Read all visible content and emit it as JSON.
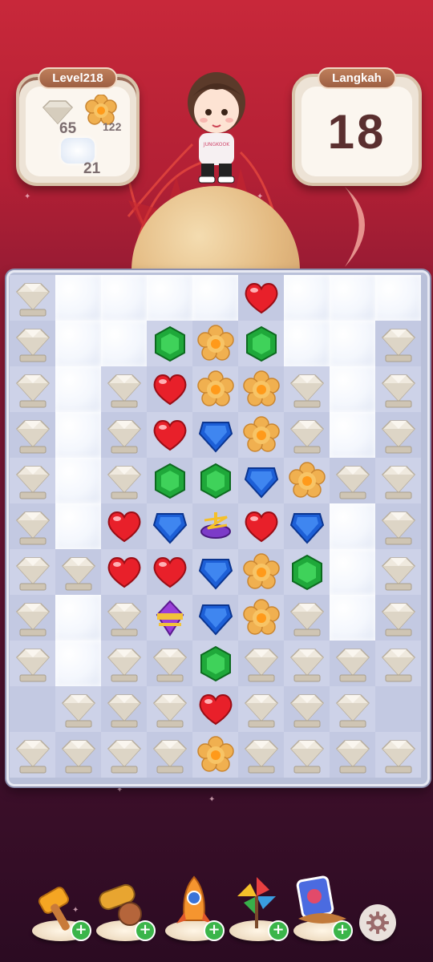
{
  "hud": {
    "level_label": "Level218",
    "moves_label": "Langkah",
    "moves_remaining": "18"
  },
  "goals": [
    {
      "icon": "stone-diamond-icon",
      "count": "65"
    },
    {
      "icon": "cookie-flower-icon",
      "count": "122"
    },
    {
      "icon": "cloud-block-icon",
      "count": "21"
    }
  ],
  "character": {
    "shirt_text": "JUNGKOOK"
  },
  "board": {
    "legend": {
      "S": "stone-block",
      "C": "cloud-block",
      "E": "empty",
      "R": "red-heart",
      "G": "green-gem",
      "B": "blue-gem",
      "F": "cookie-flower",
      "T": "spinning-top-booster",
      "P": "purple-bomb-booster"
    },
    "rows": [
      "SCCCCRCCCS",
      "SCCGFGCCS",
      "SCSRFFSCS",
      "SCSRBFSCS",
      "SCSGGBFSS",
      "SCRBTRBCS",
      "SSRRBFGCS",
      "SCSPBFSCS",
      "SCSSGSSSS",
      "ESSSRSSSE",
      "SSSSFSSSS"
    ]
  },
  "toolbar": {
    "items": [
      {
        "name": "hammer",
        "icon": "hammer-icon"
      },
      {
        "name": "cannon",
        "icon": "cannon-icon"
      },
      {
        "name": "rocket",
        "icon": "rocket-icon"
      },
      {
        "name": "pinwheel",
        "icon": "pinwheel-icon"
      },
      {
        "name": "shuffle-card",
        "icon": "card-icon"
      }
    ],
    "settings_icon": "gear-icon"
  },
  "colors": {
    "background_top": "#c8283a",
    "background_bottom": "#2b0b22",
    "panel": "#fbf6ef",
    "tag": "#b06f4e",
    "moves_text": "#5a2f2f"
  }
}
